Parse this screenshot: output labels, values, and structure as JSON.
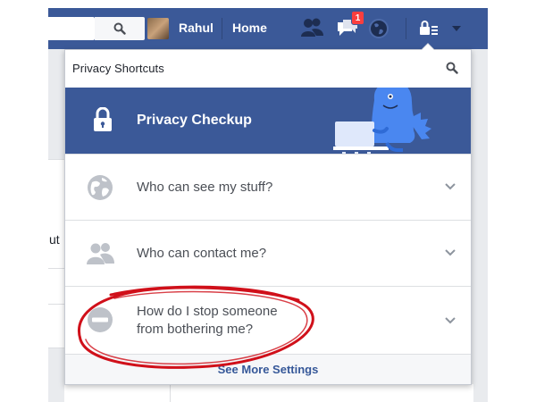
{
  "colors": {
    "brand_blue": "#3b5998",
    "link_blue": "#365899",
    "notification_red": "#fa3e3e",
    "annotation_red": "#d0101a",
    "row_text": "#4b4f56",
    "icon_gray": "#bec2c9"
  },
  "topbar": {
    "user_name": "Rahul",
    "home_label": "Home",
    "notification_count": "1",
    "icons": [
      "search-icon",
      "friend-requests-icon",
      "messages-icon",
      "notifications-globe-icon",
      "privacy-shortcuts-icon",
      "caret-down-icon"
    ]
  },
  "background_page": {
    "partial_text": "ut"
  },
  "privacy_menu": {
    "title": "Privacy Shortcuts",
    "checkup_label": "Privacy Checkup",
    "items": [
      {
        "label": "Who can see my stuff?",
        "icon": "globe-icon"
      },
      {
        "label": "Who can contact me?",
        "icon": "people-icon"
      },
      {
        "label_line1": "How do I stop someone",
        "label_line2": "from bothering me?",
        "icon": "block-icon",
        "highlighted": true
      }
    ],
    "footer_link": "See More Settings"
  }
}
